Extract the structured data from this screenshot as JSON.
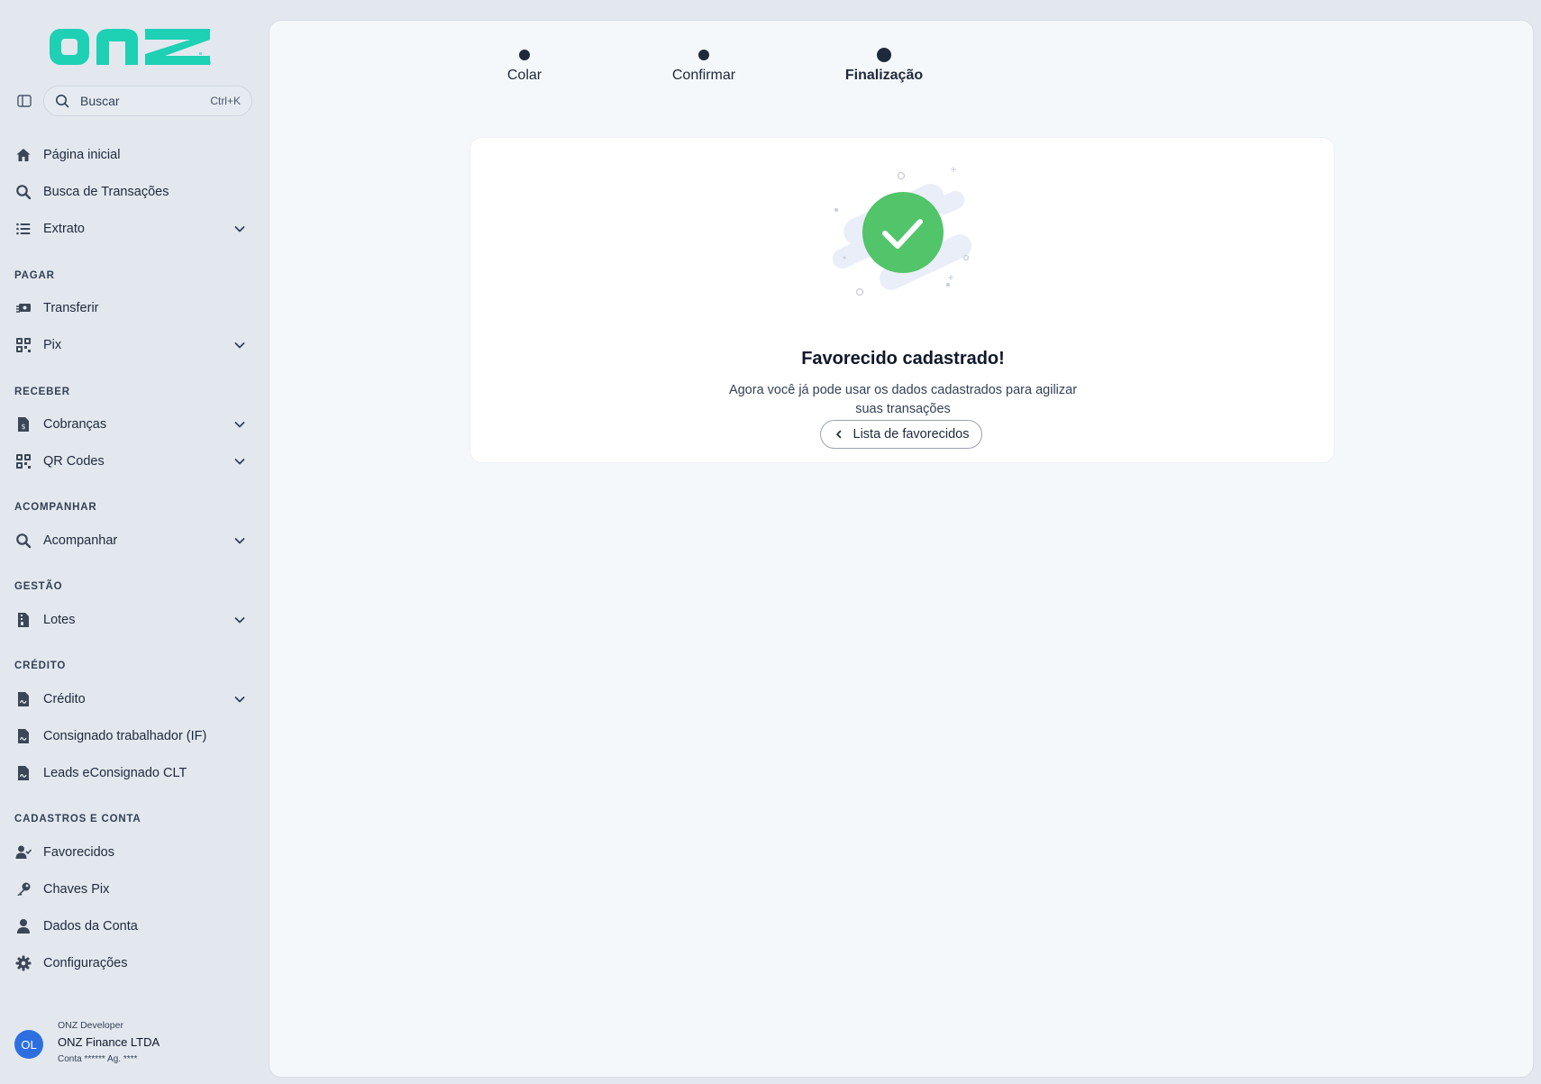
{
  "brand": {
    "logo_text": "onz",
    "accent": "#1ed0b4"
  },
  "search": {
    "label": "Buscar",
    "shortcut": "Ctrl+K"
  },
  "nav": {
    "home": "Página inicial",
    "transactions": "Busca de Transações",
    "statement": "Extrato",
    "section_pay": "PAGAR",
    "transfer": "Transferir",
    "pix": "Pix",
    "section_receive": "RECEBER",
    "charges": "Cobranças",
    "qrcodes": "QR Codes",
    "section_track": "ACOMPANHAR",
    "track": "Acompanhar",
    "section_management": "GESTÃO",
    "batches": "Lotes",
    "section_credit": "CRÉDITO",
    "credit": "Crédito",
    "payroll": "Consignado trabalhador (IF)",
    "leads": "Leads eConsignado CLT",
    "section_accounts": "CADASTROS E CONTA",
    "payees": "Favorecidos",
    "pix_keys": "Chaves Pix",
    "account_data": "Dados da Conta",
    "settings": "Configurações"
  },
  "user": {
    "initials": "OL",
    "role": "ONZ Developer",
    "company": "ONZ Finance LTDA",
    "account": "Conta ****** Ag. ****"
  },
  "stepper": {
    "steps": [
      "Colar",
      "Confirmar",
      "Finalização"
    ],
    "active_index": 2
  },
  "result": {
    "title": "Favorecido cadastrado!",
    "message": "Agora você já pode usar os dados cadastrados para agilizar suas transações",
    "button": "Lista de favorecidos",
    "success_color": "#52c46a"
  }
}
